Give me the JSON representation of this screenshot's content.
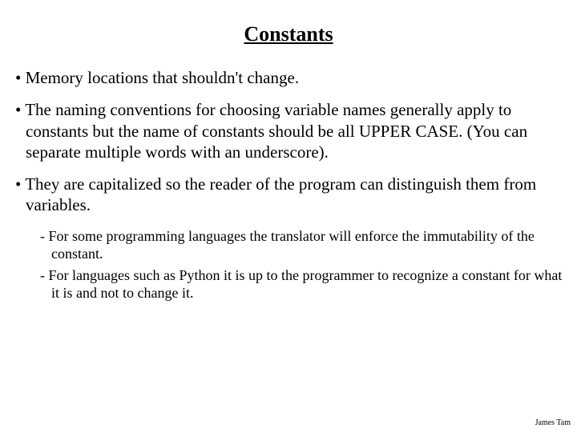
{
  "title": "Constants",
  "bullets": [
    {
      "text": "Memory locations that shouldn't change."
    },
    {
      "text": "The naming conventions for choosing variable names generally apply to constants but the name of constants should be all UPPER CASE.  (You can separate multiple words with an underscore)."
    },
    {
      "text": "They are capitalized so the reader of the program can distinguish them from variables."
    }
  ],
  "subbullets": [
    {
      "text": "For some programming languages the translator will enforce the immutability of the constant."
    },
    {
      "text": "For languages such as Python it is up to the programmer to recognize a constant for what it is and not to change it."
    }
  ],
  "footer": "James Tam"
}
